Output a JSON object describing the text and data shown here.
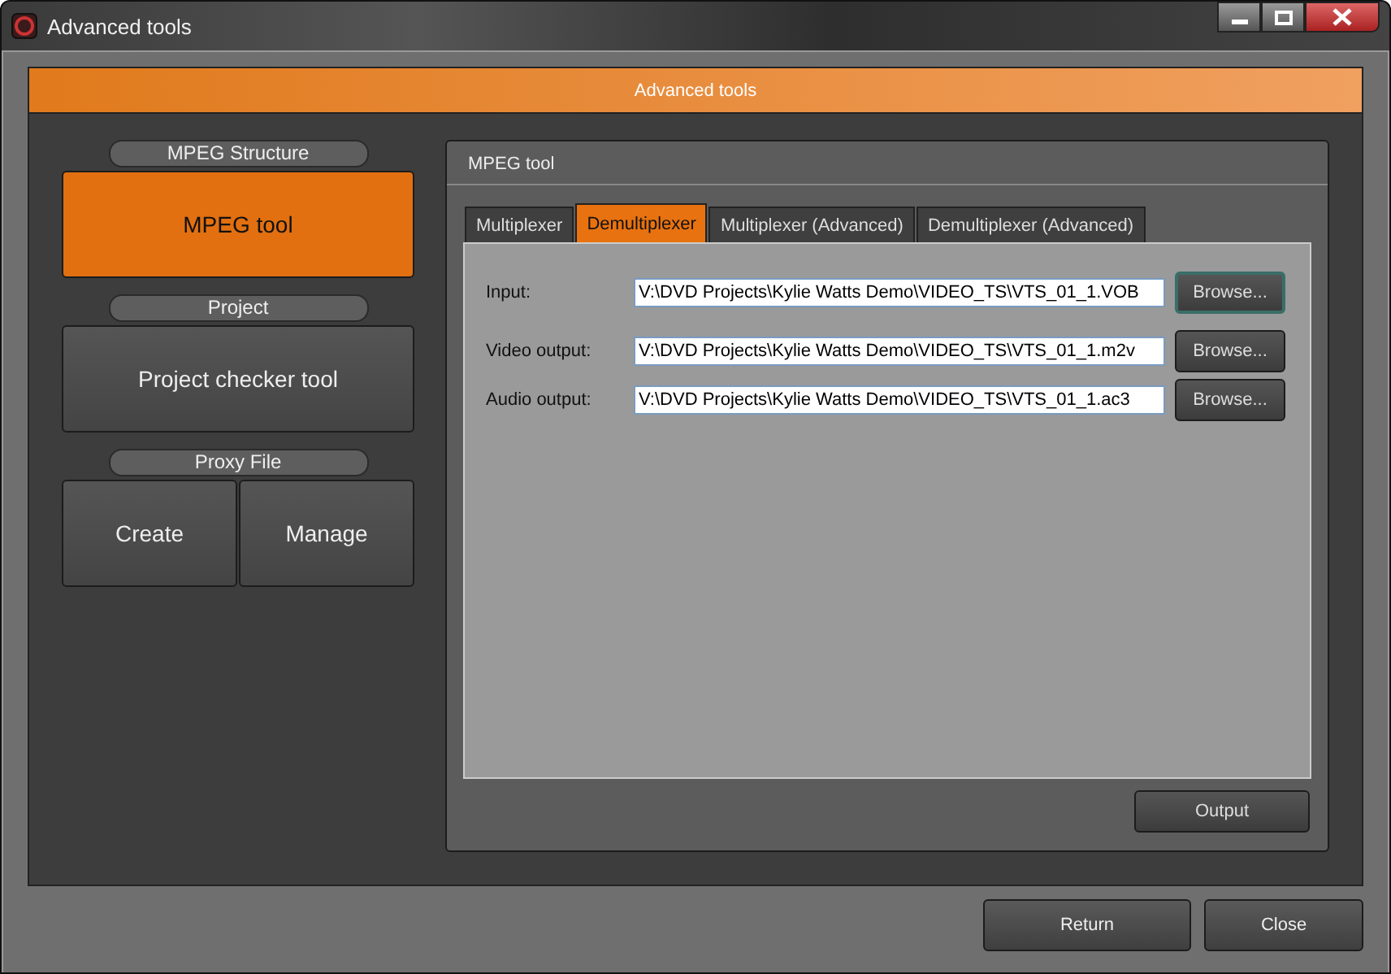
{
  "window": {
    "title": "Advanced tools"
  },
  "header": "Advanced tools",
  "sidebar": {
    "sections": [
      {
        "heading": "MPEG Structure",
        "buttons": [
          {
            "label": "MPEG tool",
            "selected": true
          }
        ]
      },
      {
        "heading": "Project",
        "buttons": [
          {
            "label": "Project checker tool",
            "selected": false
          }
        ]
      },
      {
        "heading": "Proxy File",
        "buttons": [
          {
            "label": "Create",
            "selected": false
          },
          {
            "label": "Manage",
            "selected": false
          }
        ]
      }
    ]
  },
  "panel": {
    "title": "MPEG tool",
    "tabs": [
      {
        "label": "Multiplexer",
        "selected": false
      },
      {
        "label": "Demultiplexer",
        "selected": true
      },
      {
        "label": "Multiplexer (Advanced)",
        "selected": false
      },
      {
        "label": "Demultiplexer (Advanced)",
        "selected": false
      }
    ],
    "fields": [
      {
        "label": "Input:",
        "value": "V:\\DVD Projects\\Kylie Watts Demo\\VIDEO_TS\\VTS_01_1.VOB",
        "button": "Browse...",
        "focused": true
      },
      {
        "label": "Video output:",
        "value": "V:\\DVD Projects\\Kylie Watts Demo\\VIDEO_TS\\VTS_01_1.m2v",
        "button": "Browse...",
        "focused": false
      },
      {
        "label": "Audio output:",
        "value": "V:\\DVD Projects\\Kylie Watts Demo\\VIDEO_TS\\VTS_01_1.ac3",
        "button": "Browse...",
        "focused": false
      }
    ],
    "action": "Output"
  },
  "buttons": [
    "Return",
    "Close"
  ]
}
